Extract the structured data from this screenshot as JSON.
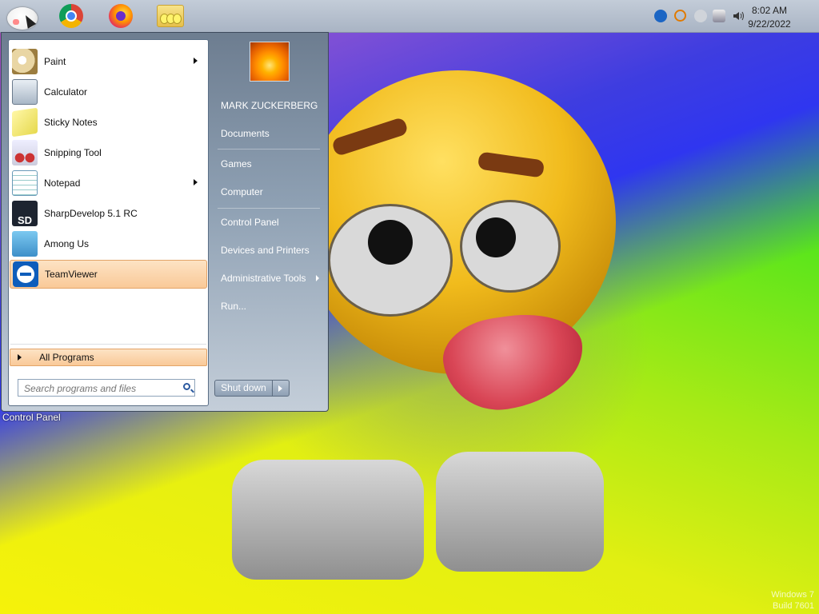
{
  "taskbar": {
    "pinned": [
      {
        "name": "start-orb",
        "icon": "windows-orb-icon"
      },
      {
        "name": "chrome",
        "icon": "chrome-icon"
      },
      {
        "name": "firefox",
        "icon": "firefox-icon"
      },
      {
        "name": "file-explorer",
        "icon": "folder-icon"
      }
    ],
    "tray": {
      "icons": [
        "teamviewer-tray-icon",
        "search-tray-icon",
        "emoji-tray-icon",
        "network-icon",
        "volume-icon"
      ],
      "time": "8:02 AM",
      "date": "9/22/2022"
    }
  },
  "start_menu": {
    "programs": [
      {
        "label": "Paint",
        "icon": "paint-icon",
        "submenu": true
      },
      {
        "label": "Calculator",
        "icon": "calculator-icon",
        "submenu": false
      },
      {
        "label": "Sticky Notes",
        "icon": "sticky-notes-icon",
        "submenu": false
      },
      {
        "label": "Snipping Tool",
        "icon": "snipping-tool-icon",
        "submenu": false
      },
      {
        "label": "Notepad",
        "icon": "notepad-icon",
        "submenu": true
      },
      {
        "label": "SharpDevelop 5.1 RC",
        "icon": "sharpdevelop-icon",
        "submenu": false
      },
      {
        "label": "Among Us",
        "icon": "among-us-icon",
        "submenu": false
      },
      {
        "label": "TeamViewer",
        "icon": "teamviewer-icon",
        "submenu": false,
        "highlighted": true
      }
    ],
    "all_programs": "All Programs",
    "search_placeholder": "Search programs and files",
    "sharpdevelop_badge": "SD",
    "right_pane": {
      "user": "MARK ZUCKERBERG",
      "items": [
        "Documents",
        "Games",
        "Computer",
        "Control Panel",
        "Devices and Printers",
        "Administrative Tools",
        "Run..."
      ]
    },
    "shutdown_label": "Shut down"
  },
  "tooltip": "Control Panel",
  "watermark": [
    "Windows 7",
    "Build 7601"
  ]
}
